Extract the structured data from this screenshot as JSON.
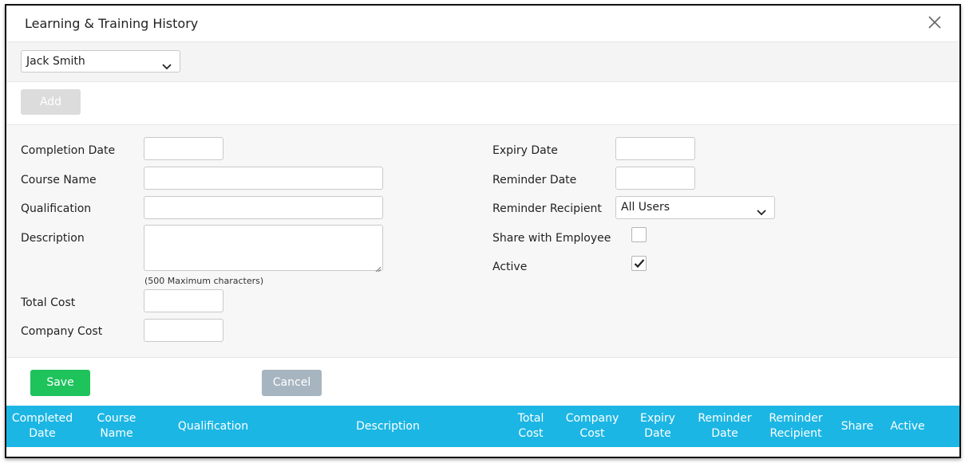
{
  "dialog": {
    "title": "Learning & Training History"
  },
  "employee_select": {
    "value": "Jack Smith"
  },
  "toolbar": {
    "add_label": "Add"
  },
  "form": {
    "completion_date_label": "Completion Date",
    "course_name_label": "Course Name",
    "qualification_label": "Qualification",
    "description_label": "Description",
    "description_hint": "(500 Maximum characters)",
    "total_cost_label": "Total Cost",
    "company_cost_label": "Company Cost",
    "expiry_date_label": "Expiry Date",
    "reminder_date_label": "Reminder Date",
    "reminder_recipient_label": "Reminder Recipient",
    "reminder_recipient_value": "All Users",
    "share_with_employee_label": "Share with Employee",
    "share_with_employee_checked": false,
    "active_label": "Active",
    "active_checked": true,
    "completion_date_value": "",
    "course_name_value": "",
    "qualification_value": "",
    "description_value": "",
    "total_cost_value": "",
    "company_cost_value": "",
    "expiry_date_value": "",
    "reminder_date_value": ""
  },
  "actions": {
    "save_label": "Save",
    "cancel_label": "Cancel"
  },
  "table": {
    "columns": [
      "Completed\nDate",
      "Course\nName",
      "Qualification",
      "Description",
      "Total\nCost",
      "Company\nCost",
      "Expiry\nDate",
      "Reminder\nDate",
      "Reminder\nRecipient",
      "Share",
      "Active"
    ],
    "header_color": "#1cb6e4"
  },
  "colors": {
    "save_button": "#1ec35c",
    "cancel_button": "#a7b5c0",
    "add_button_disabled": "#dcdcdc"
  },
  "icons": {
    "close": "close-icon",
    "dropdown": "chevron-down-icon",
    "check": "checkmark-icon"
  }
}
